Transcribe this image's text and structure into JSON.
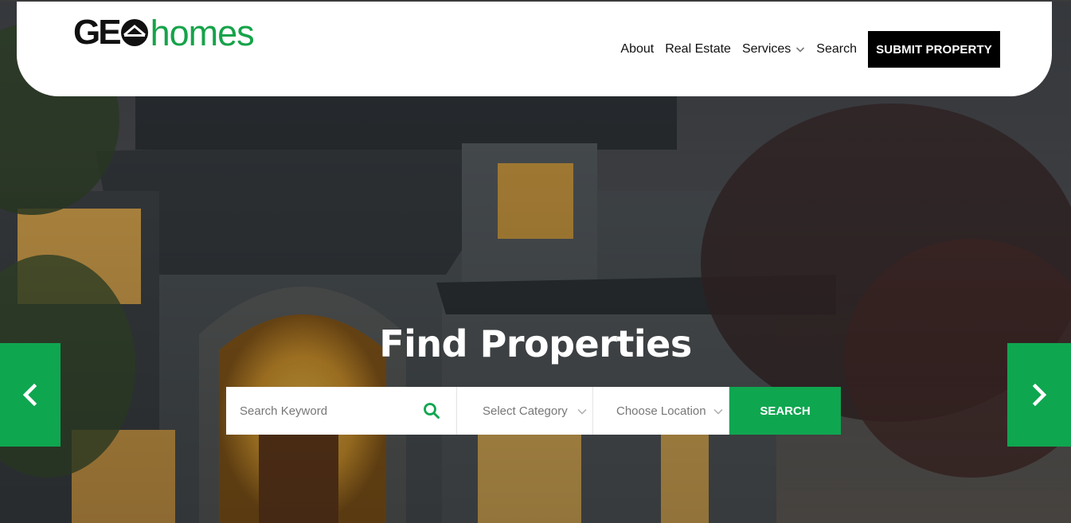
{
  "brand": {
    "logo_part1": "GE",
    "logo_part2": "homes",
    "brand_color": "#16a34a"
  },
  "nav": {
    "items": [
      {
        "label": "About"
      },
      {
        "label": "Real Estate"
      },
      {
        "label": "Services",
        "has_dropdown": true
      },
      {
        "label": "Search"
      }
    ],
    "cta_label": "SUBMIT PROPERTY"
  },
  "hero": {
    "title": "Find Properties",
    "search": {
      "keyword_placeholder": "Search Keyword",
      "category_value": "Select Category",
      "location_value": "Choose Location",
      "button_label": "SEARCH"
    },
    "prev_icon": "chevron-left-icon",
    "next_icon": "chevron-right-icon"
  },
  "colors": {
    "accent": "#0fa650",
    "header_bg": "#ffffff",
    "cta_bg": "#000000"
  }
}
